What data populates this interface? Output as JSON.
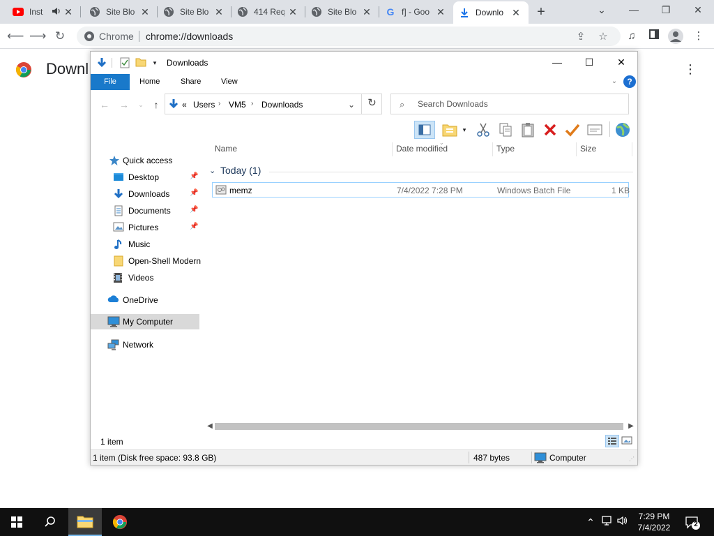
{
  "browser": {
    "tabs": [
      {
        "title": "Inst",
        "favicon": "youtube-icon",
        "audio": true,
        "active": false
      },
      {
        "title": "Site Blo",
        "favicon": "globe-icon",
        "active": false
      },
      {
        "title": "Site Blo",
        "favicon": "globe-icon",
        "active": false
      },
      {
        "title": "414 Req",
        "favicon": "globe-icon",
        "active": false
      },
      {
        "title": "Site Blo",
        "favicon": "globe-icon",
        "active": false
      },
      {
        "title": "f] - Goo",
        "favicon": "google-icon",
        "active": false
      },
      {
        "title": "Downlo",
        "favicon": "download-icon",
        "active": true
      }
    ],
    "new_tab": "+",
    "omnibox": {
      "chip": "Chrome",
      "url": "chrome://downloads"
    },
    "colors": {
      "tabstrip": "#dee1e6",
      "accent": "#1a73e8"
    }
  },
  "downloads_page": {
    "title": "Downloads"
  },
  "explorer": {
    "title": "Downloads",
    "ribbon": {
      "file": "File",
      "tabs": [
        "Home",
        "Share",
        "View"
      ],
      "help": "?"
    },
    "address": {
      "prefix": "«",
      "crumbs": [
        "Users",
        "VM5",
        "Downloads"
      ]
    },
    "search_placeholder": "Search Downloads",
    "nav": [
      {
        "label": "Quick access",
        "icon": "star-icon",
        "pinned": false
      },
      {
        "label": "Desktop",
        "icon": "desktop-folder-icon",
        "pinned": true
      },
      {
        "label": "Downloads",
        "icon": "downloads-folder-icon",
        "pinned": true
      },
      {
        "label": "Documents",
        "icon": "documents-folder-icon",
        "pinned": true
      },
      {
        "label": "Pictures",
        "icon": "pictures-folder-icon",
        "pinned": true
      },
      {
        "label": "Music",
        "icon": "music-icon",
        "pinned": false
      },
      {
        "label": "Open-Shell Modern",
        "icon": "folder-icon",
        "pinned": false
      },
      {
        "label": "Videos",
        "icon": "videos-folder-icon",
        "pinned": false
      },
      {
        "label": "OneDrive",
        "icon": "onedrive-icon",
        "pinned": false
      },
      {
        "label": "My Computer",
        "icon": "computer-icon",
        "pinned": false,
        "selected": true
      },
      {
        "label": "Network",
        "icon": "network-icon",
        "pinned": false
      }
    ],
    "columns": [
      "Name",
      "Date modified",
      "Type",
      "Size"
    ],
    "group": {
      "label": "Today (1)"
    },
    "files": [
      {
        "name": "memz",
        "date": "7/4/2022 7:28 PM",
        "type": "Windows Batch File",
        "size": "1 KB"
      }
    ],
    "status": {
      "count": "1 item"
    },
    "details": {
      "summary": "1 item (Disk free space: 93.8 GB)",
      "bytes": "487 bytes",
      "location": "Computer"
    }
  },
  "taskbar": {
    "time": "7:29 PM",
    "date": "7/4/2022",
    "notifications": "2"
  }
}
